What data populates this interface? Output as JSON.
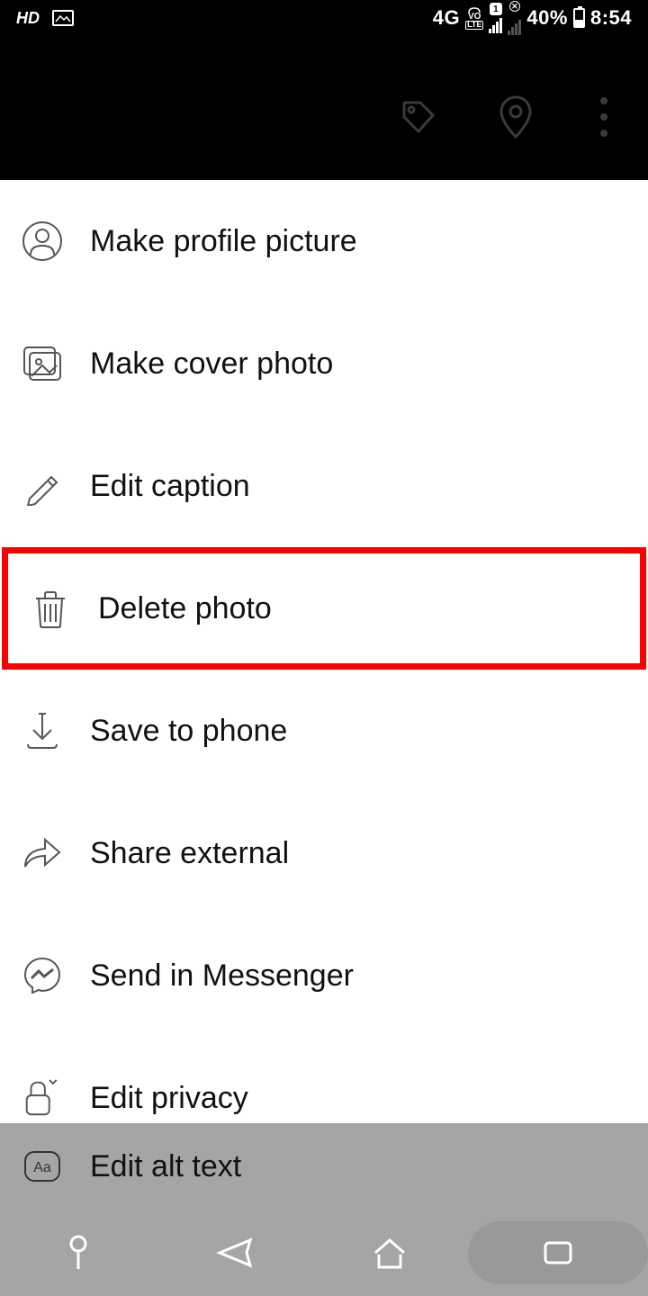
{
  "status_bar": {
    "hd": "HD",
    "network": "4G",
    "volte": "VO LTE",
    "battery_pct": "40%",
    "time": "8:54"
  },
  "menu": {
    "items": [
      {
        "label": "Make profile picture",
        "icon": "profile-icon"
      },
      {
        "label": "Make cover photo",
        "icon": "cover-photo-icon"
      },
      {
        "label": "Edit caption",
        "icon": "pencil-icon"
      },
      {
        "label": "Delete photo",
        "icon": "trash-icon",
        "highlight": true
      },
      {
        "label": "Save to phone",
        "icon": "download-icon"
      },
      {
        "label": "Share external",
        "icon": "share-icon"
      },
      {
        "label": "Send in Messenger",
        "icon": "messenger-icon"
      },
      {
        "label": "Edit privacy",
        "icon": "lock-icon"
      },
      {
        "label": "Edit alt text",
        "icon": "alt-text-icon"
      }
    ]
  }
}
